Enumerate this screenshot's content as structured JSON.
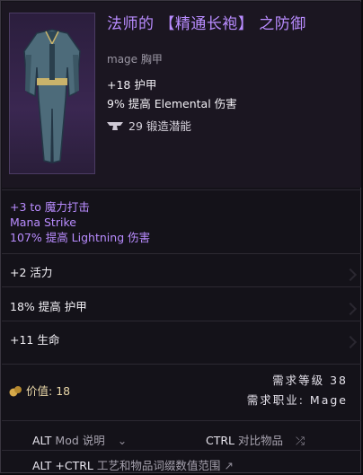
{
  "item": {
    "title": "法师的 【精通长袍】 之防御",
    "subtype": "mage 胸甲",
    "base_stats": [
      "+18 护甲",
      "9% 提高 Elemental 伤害"
    ],
    "forging_potential": "29 锻造潜能"
  },
  "affixes": [
    "+3 to 魔力打击",
    "Mana Strike",
    "107% 提高 Lightning 伤害"
  ],
  "mods": [
    "+2 活力",
    "18% 提高 护甲",
    "+11 生命"
  ],
  "value": {
    "label": "价值:",
    "amount": "18"
  },
  "requirements": {
    "level_label": "需求等级",
    "level": "38",
    "class_label": "需求职业:",
    "class": "Mage"
  },
  "footer": {
    "alt_key": "ALT",
    "mod_desc": "Mod 说明",
    "ctrl_key": "CTRL",
    "compare": "对比物品",
    "alt_ctrl_key": "ALT +CTRL",
    "affix_range": "工艺和物品词缀数值范围"
  },
  "colors": {
    "unique_purple": "#b98cff",
    "gold_text": "#e9d7a8",
    "background": "#141219"
  }
}
